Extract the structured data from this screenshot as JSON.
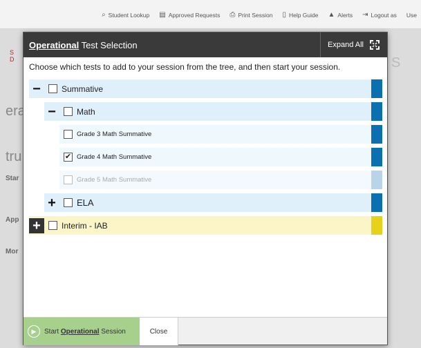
{
  "nav": {
    "items": [
      {
        "icon": "search-icon",
        "label": "Student Lookup"
      },
      {
        "icon": "document-icon",
        "label": "Approved Requests"
      },
      {
        "icon": "printer-icon",
        "label": "Print Session"
      },
      {
        "icon": "book-icon",
        "label": "Help Guide"
      },
      {
        "icon": "alert-icon",
        "label": "Alerts"
      },
      {
        "icon": "logout-icon",
        "label": "Logout as"
      },
      {
        "label": "Use"
      }
    ]
  },
  "modal": {
    "title_prefix": "Operational",
    "title_rest": " Test Selection",
    "expand_label": "Expand All",
    "instructions": "Choose which tests to add to your session from the tree, and then start your session."
  },
  "tree": {
    "summative": {
      "toggle": "−",
      "label": "Summative",
      "bg": "#dff0fb",
      "bar": "#0a70b0"
    },
    "math": {
      "toggle": "−",
      "label": "Math",
      "bg": "#dff0fb",
      "bar": "#0a70b0"
    },
    "grade3": {
      "label": "Grade 3 Math Summative",
      "checked": false,
      "bar": "#0a70b0"
    },
    "grade4": {
      "label": "Grade 4 Math Summative",
      "checked": true,
      "check": "✔",
      "bar": "#0a70b0"
    },
    "grade5": {
      "label": "Grade 5 Math Summative",
      "disabled": true,
      "bar": "#b7d4e8"
    },
    "ela": {
      "toggle": "+",
      "label": "ELA",
      "bg": "#dff0fb",
      "bar": "#0a70b0"
    },
    "interim": {
      "toggle": "+",
      "label": "Interim - IAB",
      "bg": "#fbf5c8",
      "bar": "#e6d21a"
    }
  },
  "footer": {
    "start_prefix": "Start ",
    "start_bold": "Operational",
    "start_suffix": " Session",
    "close_label": "Close"
  }
}
